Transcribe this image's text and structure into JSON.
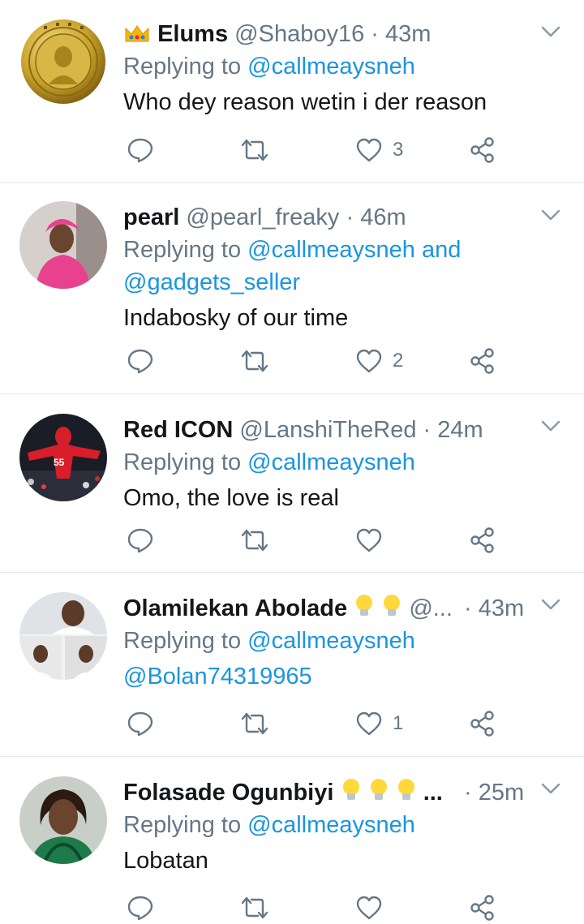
{
  "tweets": [
    {
      "name": "Elums",
      "handle": "@Shaboy16",
      "separator": "·",
      "time": "43m",
      "replying_label": "Replying to",
      "mentions_line1": "@callmeaysneh",
      "mentions_line2": "",
      "text": "Who dey reason wetin i der reason",
      "text_is_link": false,
      "like_count": "3",
      "avatar_icon": "coin-avatar",
      "name_icon": "crown-icon"
    },
    {
      "name": "pearl",
      "handle": "@pearl_freaky",
      "separator": "·",
      "time": "46m",
      "replying_label": "Replying to",
      "mentions_line1": "@callmeaysneh and",
      "mentions_line2": "@gadgets_seller",
      "text": "Indabosky of our time",
      "text_is_link": false,
      "like_count": "2",
      "avatar_icon": "woman-pink-avatar"
    },
    {
      "name": "Red ICON",
      "handle": "@LanshiTheRed",
      "separator": "·",
      "time": "24m",
      "replying_label": "Replying to",
      "mentions_line1": "@callmeaysneh",
      "mentions_line2": "",
      "text": "Omo,  the love is real",
      "text_is_link": false,
      "like_count": "",
      "avatar_icon": "mascot-55-avatar",
      "avatar_number": "55"
    },
    {
      "name": "Olamilekan Abolade",
      "handle": "@...",
      "separator": "·",
      "time": "43m",
      "replying_label": "Replying to",
      "mentions_line1": "@callmeaysneh",
      "mentions_line2": "",
      "text": "@Bolan74319965",
      "text_is_link": true,
      "like_count": "1",
      "avatar_icon": "collage-avatar",
      "name_icon": "lightbulb-icon"
    },
    {
      "name": "Folasade Ogunbiyi",
      "handle": "...",
      "separator": "·",
      "time": "25m",
      "replying_label": "Replying to",
      "mentions_line1": "@callmeaysneh",
      "mentions_line2": "",
      "text": "Lobatan",
      "text_is_link": false,
      "like_count": "",
      "avatar_icon": "woman-avatar",
      "name_icon": "lightbulb-icon"
    }
  ],
  "colors": {
    "link": "#1b95e0",
    "secondary": "#657786",
    "primary": "#14171a",
    "divider": "#e1e8ed"
  },
  "action_icons": [
    "reply-icon",
    "retweet-icon",
    "like-icon",
    "share-icon"
  ],
  "menu_icon": "chevron-down-icon"
}
